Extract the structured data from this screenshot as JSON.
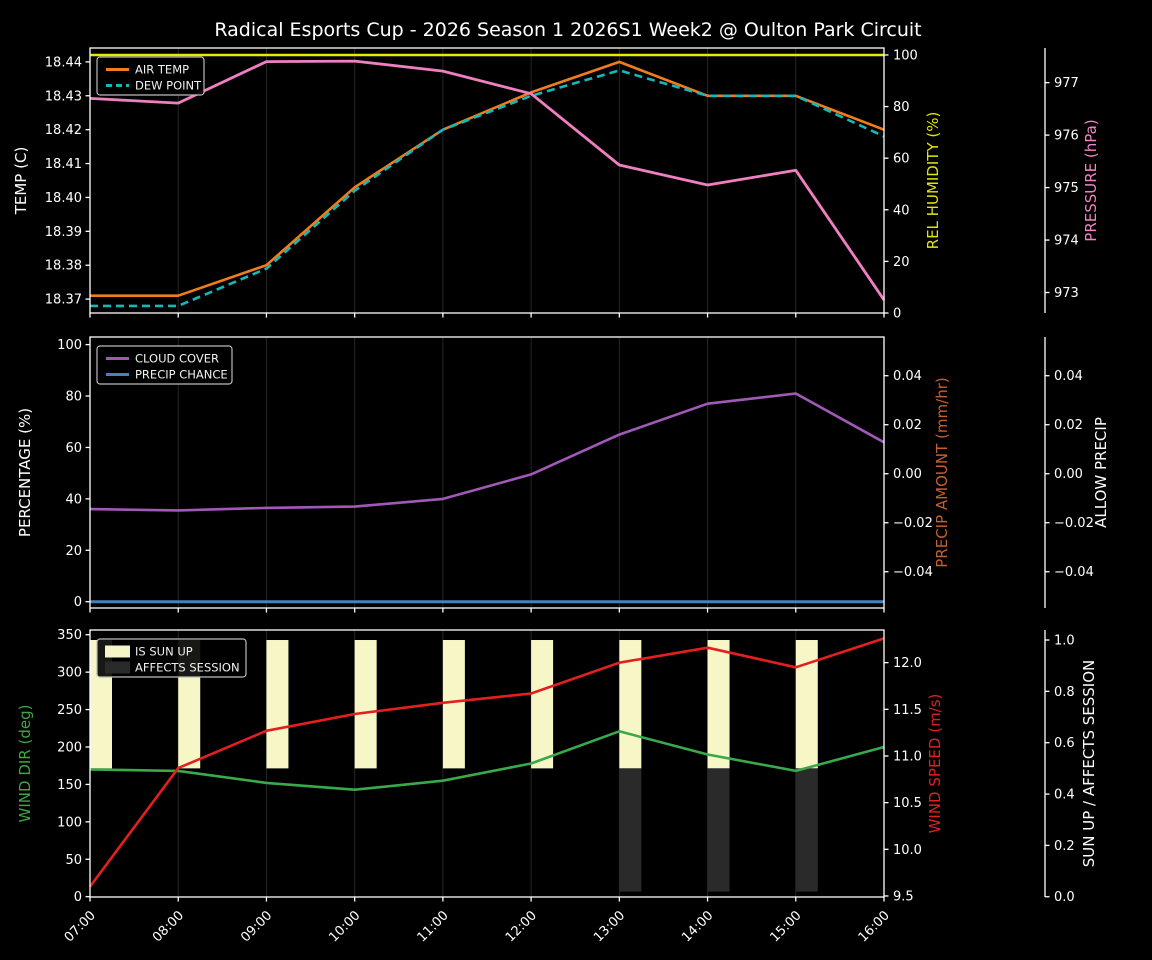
{
  "header": {
    "title": "Radical Esports Cup - 2026 Season 1 2026S1 Week2 @ Oulton Park Circuit"
  },
  "times": [
    "07:00",
    "08:00",
    "09:00",
    "10:00",
    "11:00",
    "12:00",
    "13:00",
    "14:00",
    "15:00",
    "16:00"
  ],
  "colors": {
    "background": "#000000",
    "spine": "#ffffff",
    "grid": "#262626",
    "air_temp": "#f07d1a",
    "dew_point": "#14b8b8",
    "rel_humidity": "#e8e80e",
    "pressure": "#f07fc2",
    "cloud_cover": "#a159b8",
    "precip_chance": "#4583c0",
    "precip_amount_label": "#c3602f",
    "allow_precip_label": "#ffffff",
    "wind_dir": "#3aa94a",
    "wind_speed": "#e41f1f",
    "sun_up_bar": "#f6f6c6",
    "affects_bar": "#2a2a2a",
    "text": "#ffffff"
  },
  "chart_data": [
    {
      "id": "temp-humidity-pressure",
      "type": "line",
      "grid": "vertical-only",
      "legend_position": "upper-left",
      "axes": {
        "left": {
          "label": "TEMP (C)",
          "color": "#ffffff",
          "range": [
            18.3659,
            18.4441
          ],
          "ticks": [
            {
              "v": 18.37,
              "t": "18.37"
            },
            {
              "v": 18.38,
              "t": "18.38"
            },
            {
              "v": 18.39,
              "t": "18.39"
            },
            {
              "v": 18.4,
              "t": "18.40"
            },
            {
              "v": 18.41,
              "t": "18.41"
            },
            {
              "v": 18.42,
              "t": "18.42"
            },
            {
              "v": 18.43,
              "t": "18.43"
            },
            {
              "v": 18.44,
              "t": "18.44"
            }
          ]
        },
        "right1": {
          "label": "REL HUMIDITY (%)",
          "color": "#e3e30e",
          "range": [
            0,
            102.7
          ],
          "ticks": [
            {
              "v": 0,
              "t": "0"
            },
            {
              "v": 20,
              "t": "20"
            },
            {
              "v": 40,
              "t": "40"
            },
            {
              "v": 60,
              "t": "60"
            },
            {
              "v": 80,
              "t": "80"
            },
            {
              "v": 100,
              "t": "100"
            }
          ]
        },
        "right2": {
          "label": "PRESSURE (hPa)",
          "color": "#f283c3",
          "range": [
            972.61,
            977.66
          ],
          "ticks": [
            {
              "v": 973,
              "t": "973"
            },
            {
              "v": 974,
              "t": "974"
            },
            {
              "v": 975,
              "t": "975"
            },
            {
              "v": 976,
              "t": "976"
            },
            {
              "v": 977,
              "t": "977"
            }
          ]
        }
      },
      "series": [
        {
          "name": "AIR TEMP",
          "axis": "left",
          "color": "#f07d1a",
          "dash": false,
          "width": 2.6,
          "in_legend": true,
          "values": [
            18.371,
            18.371,
            18.38,
            18.403,
            18.42,
            18.431,
            18.44,
            18.43,
            18.43,
            18.42
          ]
        },
        {
          "name": "DEW POINT",
          "axis": "left",
          "color": "#14b8b8",
          "dash": true,
          "width": 2.6,
          "in_legend": true,
          "values": [
            18.368,
            18.368,
            18.379,
            18.402,
            18.42,
            18.43,
            18.4375,
            18.43,
            18.43,
            18.418
          ]
        },
        {
          "name": "REL HUMIDITY",
          "axis": "right1",
          "color": "#e8e80e",
          "dash": false,
          "width": 2.6,
          "in_legend": false,
          "values": [
            100,
            100,
            100,
            100,
            100,
            100,
            100,
            100,
            100,
            100
          ]
        },
        {
          "name": "PRESSURE",
          "axis": "right2",
          "color": "#f07fc2",
          "dash": false,
          "width": 2.8,
          "in_legend": false,
          "values": [
            976.7,
            976.61,
            977.4,
            977.41,
            977.22,
            976.79,
            975.43,
            975.05,
            975.33,
            972.86
          ]
        }
      ],
      "bars": []
    },
    {
      "id": "cloud-precip",
      "type": "line",
      "grid": "vertical-only",
      "legend_position": "upper-left",
      "axes": {
        "left": {
          "label": "PERCENTAGE (%)",
          "color": "#ffffff",
          "range": [
            -2.45,
            102.96
          ],
          "ticks": [
            {
              "v": 0,
              "t": "0"
            },
            {
              "v": 20,
              "t": "20"
            },
            {
              "v": 40,
              "t": "40"
            },
            {
              "v": 60,
              "t": "60"
            },
            {
              "v": 80,
              "t": "80"
            },
            {
              "v": 100,
              "t": "100"
            }
          ]
        },
        "right1": {
          "label": "PRECIP AMOUNT (mm/hr)",
          "color": "#c3602f",
          "range": [
            -0.0548,
            0.0558
          ],
          "ticks": [
            {
              "v": -0.04,
              "t": "−0.04"
            },
            {
              "v": -0.02,
              "t": "−0.02"
            },
            {
              "v": 0.0,
              "t": "0.00"
            },
            {
              "v": 0.02,
              "t": "0.02"
            },
            {
              "v": 0.04,
              "t": "0.04"
            }
          ]
        },
        "right2": {
          "label": "ALLOW PRECIP",
          "color": "#ffffff",
          "range": [
            -0.0548,
            0.0558
          ],
          "ticks": [
            {
              "v": -0.04,
              "t": "−0.04"
            },
            {
              "v": -0.02,
              "t": "−0.02"
            },
            {
              "v": 0.0,
              "t": "0.00"
            },
            {
              "v": 0.02,
              "t": "0.02"
            },
            {
              "v": 0.04,
              "t": "0.04"
            }
          ]
        }
      },
      "series": [
        {
          "name": "CLOUD COVER",
          "axis": "left",
          "color": "#a159b8",
          "dash": false,
          "width": 2.6,
          "in_legend": true,
          "values": [
            36,
            35.5,
            36.5,
            37,
            40,
            49.5,
            65,
            77,
            81,
            62
          ]
        },
        {
          "name": "PRECIP CHANCE",
          "axis": "left",
          "color": "#4583c0",
          "dash": false,
          "width": 3,
          "in_legend": true,
          "values": [
            0,
            0,
            0,
            0,
            0,
            0,
            0,
            0,
            0,
            0
          ]
        }
      ],
      "bars": []
    },
    {
      "id": "wind-sun",
      "type": "line+bar",
      "grid": "vertical-only",
      "legend_position": "upper-left",
      "axes": {
        "left": {
          "label": "WIND DIR (deg)",
          "color": "#41a547",
          "range": [
            -0.4,
            356.3
          ],
          "ticks": [
            {
              "v": 0,
              "t": "0"
            },
            {
              "v": 50,
              "t": "50"
            },
            {
              "v": 100,
              "t": "100"
            },
            {
              "v": 150,
              "t": "150"
            },
            {
              "v": 200,
              "t": "200"
            },
            {
              "v": 250,
              "t": "250"
            },
            {
              "v": 300,
              "t": "300"
            },
            {
              "v": 350,
              "t": "350"
            }
          ]
        },
        "right1": {
          "label": "WIND SPEED (m/s)",
          "color": "#e12120",
          "range": [
            9.489,
            12.35
          ],
          "ticks": [
            {
              "v": 9.5,
              "t": "9.5"
            },
            {
              "v": 10.0,
              "t": "10.0"
            },
            {
              "v": 10.5,
              "t": "10.5"
            },
            {
              "v": 11.0,
              "t": "11.0"
            },
            {
              "v": 11.5,
              "t": "11.5"
            },
            {
              "v": 12.0,
              "t": "12.0"
            }
          ]
        },
        "right2": {
          "label": "SUN UP / AFFECTS SESSION",
          "color": "#ffffff",
          "range": [
            -0.001,
            1.039
          ],
          "ticks": [
            {
              "v": 0.0,
              "t": "0.0"
            },
            {
              "v": 0.2,
              "t": "0.2"
            },
            {
              "v": 0.4,
              "t": "0.4"
            },
            {
              "v": 0.6,
              "t": "0.6"
            },
            {
              "v": 0.8,
              "t": "0.8"
            },
            {
              "v": 1.0,
              "t": "1.0"
            }
          ]
        }
      },
      "series": [
        {
          "name": "WIND DIR",
          "axis": "left",
          "color": "#3aa94a",
          "dash": false,
          "width": 2.6,
          "in_legend": false,
          "values": [
            170,
            168,
            152,
            143,
            155,
            178,
            221,
            190,
            168,
            200
          ]
        },
        {
          "name": "WIND SPEED",
          "axis": "right1",
          "color": "#e41f1f",
          "dash": false,
          "width": 2.6,
          "in_legend": false,
          "values": [
            9.6,
            10.87,
            11.27,
            11.45,
            11.57,
            11.67,
            12.0,
            12.16,
            11.95,
            12.26
          ]
        }
      ],
      "bars": [
        {
          "name": "IS SUN UP",
          "color": "#f6f6c6",
          "axis": "right2",
          "span": [
            0.5,
            1.0
          ],
          "active": [
            1,
            1,
            1,
            1,
            1,
            1,
            1,
            1,
            1,
            0
          ],
          "in_legend": true
        },
        {
          "name": "AFFECTS SESSION",
          "color": "#2a2a2a",
          "axis": "right2",
          "span": [
            0.02,
            0.5
          ],
          "active": [
            0,
            0,
            0,
            0,
            0,
            0,
            1,
            1,
            1,
            0
          ],
          "in_legend": true
        }
      ]
    }
  ]
}
